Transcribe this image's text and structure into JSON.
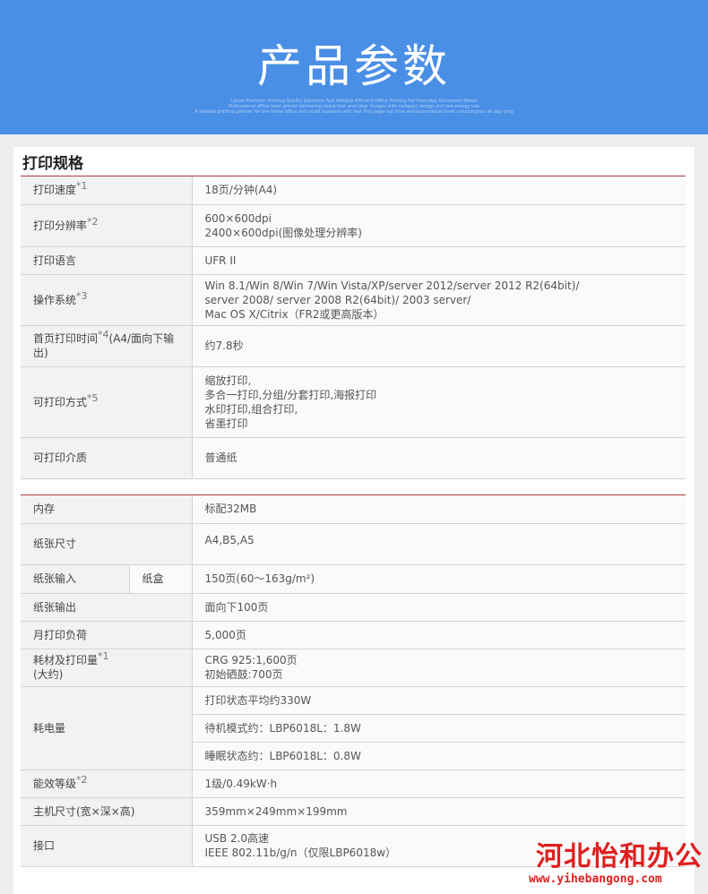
{
  "banner": {
    "title": "产品参数",
    "tagline1": "Canon Premium Printing Quality Solutions Fast Reliable Efficient Office Printing For Everyday Document Needs",
    "tagline2": "Professional office laser printer delivering sharp text and clear images with compact design and low energy use",
    "tagline3": "A reliable printing partner for the home office and small business with fast first page out time and economical toner consumption all day long"
  },
  "section": {
    "title": "打印规格"
  },
  "table1": [
    {
      "name": "row-print-speed",
      "label": "打印速度",
      "sup": "*1",
      "lines": [
        "18页/分钟(A4)"
      ]
    },
    {
      "name": "row-resolution",
      "label": "打印分辨率",
      "sup": "*2",
      "lines": [
        "600×600dpi",
        "2400×600dpi(图像处理分辨率)"
      ]
    },
    {
      "name": "row-language",
      "label": "打印语言",
      "sup": "",
      "lines": [
        "UFR II"
      ]
    },
    {
      "name": "row-os",
      "label": "操作系统",
      "sup": "*3",
      "lines": [
        "Win 8.1/Win 8/Win 7/Win Vista/XP/server 2012/server 2012 R2(64bit)/",
        "server 2008/ server 2008 R2(64bit)/ 2003 server/",
        "Mac OS X/Citrix（FR2或更高版本）"
      ]
    },
    {
      "name": "row-first-page",
      "label": "首页打印时间",
      "sup": "*4",
      "label_suffix": "(A4/面向下输出)",
      "lines": [
        "约7.8秒"
      ]
    },
    {
      "name": "row-print-modes",
      "label": "可打印方式",
      "sup": "*5",
      "lines": [
        "缩放打印,",
        "多合一打印,分组/分套打印,海报打印",
        "水印打印,组合打印,",
        "省墨打印"
      ]
    },
    {
      "name": "row-media",
      "label": "可打印介质",
      "sup": "",
      "lines": [
        "普通纸"
      ]
    }
  ],
  "table2": {
    "memory": {
      "label": "内存",
      "value": "标配32MB"
    },
    "paper_size": {
      "label": "纸张尺寸",
      "value": "A4,B5,A5"
    },
    "paper_input": {
      "label": "纸张输入",
      "sublabel": "纸盒",
      "value": "150页(60～163g/m²)"
    },
    "paper_output": {
      "label": "纸张输出",
      "value": "面向下100页"
    },
    "duty_cycle": {
      "label": "月打印负荷",
      "value": "5,000页"
    },
    "consumables": {
      "label": "耗材及打印量",
      "sup": "*1",
      "label2": "(大约)",
      "lines": [
        "CRG 925:1,600页",
        "初始硒鼓:700页"
      ]
    },
    "power": {
      "label": "耗电量",
      "lines": [
        "打印状态平均约330W",
        "待机模式约：LBP6018L：1.8W",
        "睡眠状态约：LBP6018L：0.8W"
      ]
    },
    "energy": {
      "label": "能效等级",
      "sup": "*2",
      "value": "1级/0.49kW·h"
    },
    "dimensions": {
      "label": "主机尺寸(宽×深×高)",
      "value": "359mm×249mm×199mm"
    },
    "interface": {
      "label": "接口",
      "lines": [
        "USB 2.0高速",
        "IEEE 802.11b/g/n（仅限LBP6018w）"
      ]
    }
  },
  "watermark": {
    "name": "河北怡和办公",
    "url": "www.yihebangong.com"
  }
}
